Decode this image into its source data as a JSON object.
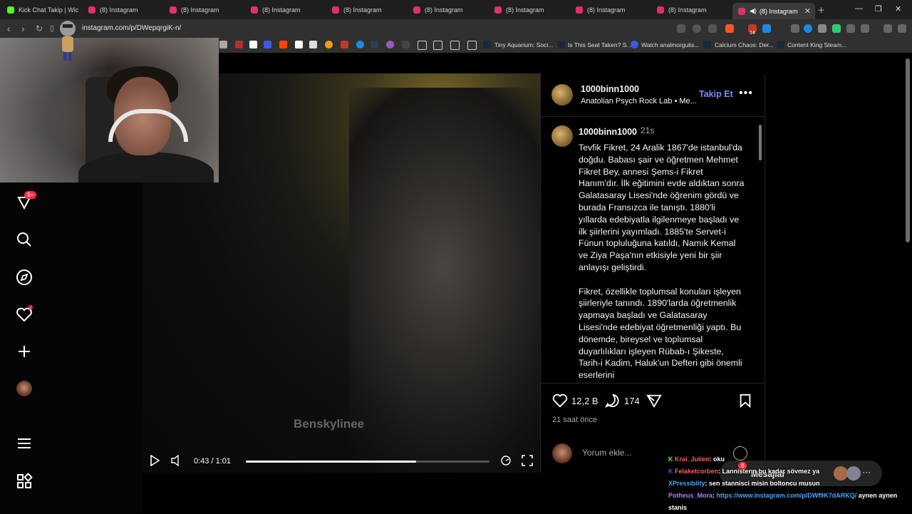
{
  "browser": {
    "tabs": [
      {
        "label": "Kick Chat Takip | Wich",
        "icon_color": "#53fc18"
      },
      {
        "label": "(8) Instagram",
        "icon_color": "#e1306c"
      },
      {
        "label": "(8) Instagram",
        "icon_color": "#e1306c"
      },
      {
        "label": "(8) Instagram",
        "icon_color": "#e1306c"
      },
      {
        "label": "(8) Instagram",
        "icon_color": "#e1306c"
      },
      {
        "label": "(8) Instagram",
        "icon_color": "#e1306c"
      },
      {
        "label": "(8) Instagram",
        "icon_color": "#e1306c"
      },
      {
        "label": "(8) Instagram",
        "icon_color": "#e1306c"
      },
      {
        "label": "(8) Instagram",
        "icon_color": "#e1306c"
      }
    ],
    "active_tab": {
      "label": "(8) Instagram"
    },
    "url": "instagram.com/p/DWepqrgiK-n/",
    "extension_badge": "14",
    "bookmarks": [
      {
        "label": "Tiny Aquarium: Soci..."
      },
      {
        "label": "Is This Seat Taken? S..."
      },
      {
        "label": "Watch analmorgulis..."
      },
      {
        "label": "Calcium Chaos: Der..."
      },
      {
        "label": "Content King Steam..."
      }
    ]
  },
  "sidebar": {
    "notifications_badge": "9+",
    "icons": [
      "heart-filter-icon",
      "search-icon",
      "explore-icon",
      "notifications-icon",
      "create-icon",
      "profile-icon",
      "menu-icon",
      "more-apps-icon"
    ]
  },
  "video": {
    "watermark": "Benskylinee",
    "time": "0:43 / 1:01",
    "progress": 0.7
  },
  "post": {
    "username": "1000binn1000",
    "subtitle": "Anatolian Psych Rock Lab • Me...",
    "follow_label": "Takip Et",
    "caption_username": "1000binn1000",
    "caption_time": "21s",
    "caption_p1": "Tevfik Fikret, 24 Aralik 1867'de istanbul'da doğdu. Babası şair ve öğretmen Mehmet Fikret Bey, annesi Şems-i Fikret Hanım'dır. İlk eğitimini evde aldıktan sonra Galatasaray Lisesi'nde öğrenim gördü ve burada Fransızca ile tanıştı. 1880'li yıllarda edebiyatla ilgilenmeye başladı ve ilk şiirlerini yayımladı. 1885'te Servet-i Fünun topluluğuna katıldı, Namık Kemal ve Ziya Paşa'nın etkisiyle yeni bir şiir anlayışı geliştirdi.",
    "caption_p2": "Fikret, özellikle toplumsal konuları işleyen şiirleriyle tanındı. 1890'larda öğretmenlik yapmaya başladı ve Galatasaray Lisesi'nde edebiyat öğretmenliği yaptı. Bu dönemde, bireysel ve toplumsal duyarlılıkları işleyen Rübab-ı Şikeste, Tarih-i Kadim, Haluk'un Defteri gibi önemli eserlerini",
    "likes": "12,2 B",
    "comments": "174",
    "posted_ago": "21 saat önce",
    "comment_placeholder": "Yorum ekle..."
  },
  "messages": {
    "label": "Mesajlar",
    "badge": "8"
  },
  "chat": [
    {
      "user": "Krai_Julien",
      "user_color": "#ff5a5a",
      "text": ": oku"
    },
    {
      "user": "Felaketcorben",
      "user_color": "#ff5a5a",
      "text": ": Lannisterın bu kadar sövmez ya"
    },
    {
      "user": "XPressiblity",
      "user_color": "#4aa3ff",
      "text": ": sen stannisci misin boltoncu musun"
    },
    {
      "user": "Potheus_Mora",
      "user_color": "#b37bff",
      "text": ": ",
      "link": "https://www.instagram.com/p/DWf9K7dARKQ/",
      "after": " aynen aynen"
    },
    {
      "user": "",
      "user_color": "#ffffff",
      "text": "stanis"
    }
  ]
}
